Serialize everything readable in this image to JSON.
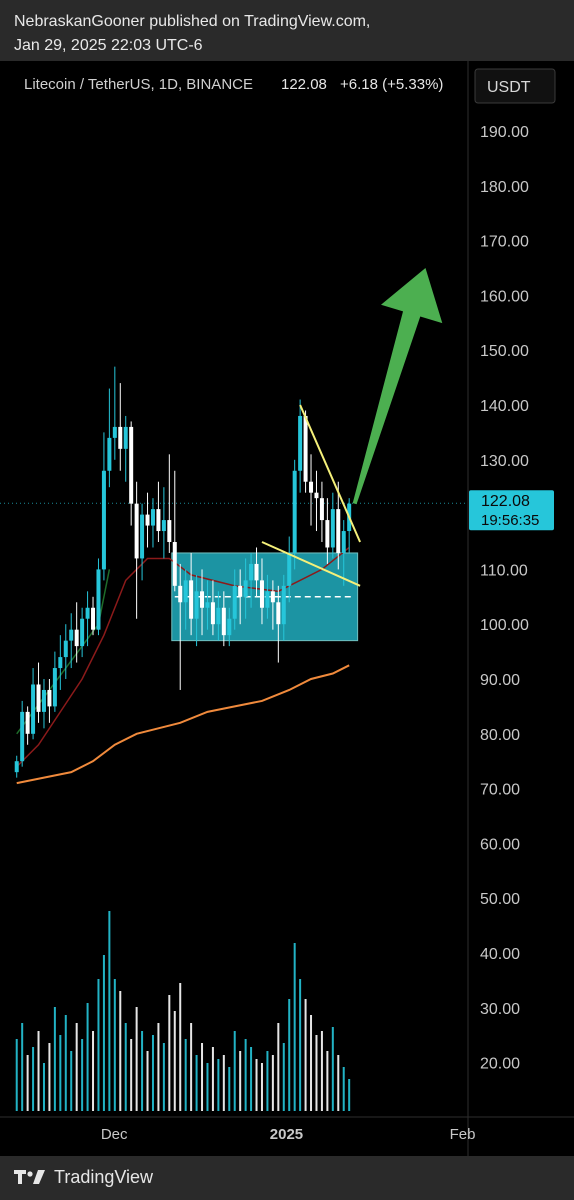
{
  "header": {
    "line1": "NebraskanGooner published on TradingView.com,",
    "line2": "Jan 29, 2025 22:03 UTC-6"
  },
  "footer": {
    "brand": "TradingView"
  },
  "chart_data": {
    "type": "candlestick",
    "symbol_line": "Litecoin / TetherUS, 1D, BINANCE",
    "last_price": "122.08",
    "change_text": "+6.18 (+5.33%)",
    "currency": "USDT",
    "countdown": "19:56:35",
    "ylim": [
      70,
      190
    ],
    "yticks": [
      "190.00",
      "180.00",
      "170.00",
      "160.00",
      "150.00",
      "140.00",
      "130.00",
      "120.00",
      "110.00",
      "100.00",
      "90.00",
      "80.00",
      "70.00",
      "60.00",
      "50.00",
      "40.00",
      "30.00",
      "20.00"
    ],
    "xticks": [
      {
        "label": "Dec",
        "index": 18,
        "bold": false
      },
      {
        "label": "2025",
        "index": 49,
        "bold": true
      },
      {
        "label": "Feb",
        "index": 82,
        "bold": false
      }
    ],
    "colors": {
      "up": "#26c6da",
      "down": "#ffffff",
      "ema_fast": "#1e6b2a",
      "ema_mid": "#8b1a1a",
      "ema_slow": "#f08a3c",
      "range_box": "#26c6da",
      "trendline": "#f5f07a",
      "arrow": "#4caf50"
    },
    "candles": [
      [
        73,
        76,
        72,
        75
      ],
      [
        75,
        86,
        74,
        84
      ],
      [
        84,
        85,
        78,
        80
      ],
      [
        80,
        92,
        79,
        89
      ],
      [
        89,
        93,
        82,
        84
      ],
      [
        84,
        90,
        81,
        88
      ],
      [
        88,
        90,
        82,
        85
      ],
      [
        85,
        95,
        84,
        92
      ],
      [
        92,
        98,
        88,
        94
      ],
      [
        94,
        100,
        90,
        97
      ],
      [
        97,
        102,
        92,
        99
      ],
      [
        99,
        104,
        93,
        96
      ],
      [
        96,
        103,
        94,
        101
      ],
      [
        101,
        106,
        96,
        103
      ],
      [
        103,
        105,
        98,
        99
      ],
      [
        99,
        112,
        98,
        110
      ],
      [
        110,
        135,
        108,
        128
      ],
      [
        128,
        143,
        125,
        134
      ],
      [
        134,
        147,
        130,
        136
      ],
      [
        136,
        144,
        128,
        132
      ],
      [
        132,
        138,
        126,
        136
      ],
      [
        136,
        137,
        118,
        122
      ],
      [
        122,
        126,
        101,
        112
      ],
      [
        112,
        122,
        108,
        120
      ],
      [
        120,
        124,
        114,
        118
      ],
      [
        118,
        123,
        114,
        121
      ],
      [
        121,
        126,
        115,
        117
      ],
      [
        117,
        125,
        112,
        119
      ],
      [
        119,
        131,
        113,
        115
      ],
      [
        115,
        128,
        106,
        107
      ],
      [
        107,
        111,
        88,
        104
      ],
      [
        104,
        110,
        99,
        108
      ],
      [
        108,
        113,
        98,
        101
      ],
      [
        101,
        109,
        96,
        106
      ],
      [
        106,
        110,
        98,
        103
      ],
      [
        103,
        108,
        99,
        104
      ],
      [
        104,
        108,
        98,
        100
      ],
      [
        100,
        106,
        97,
        103
      ],
      [
        103,
        106,
        96,
        98
      ],
      [
        98,
        103,
        96,
        101
      ],
      [
        101,
        110,
        99,
        107
      ],
      [
        107,
        110,
        100,
        105
      ],
      [
        105,
        112,
        101,
        108
      ],
      [
        108,
        113,
        103,
        111
      ],
      [
        111,
        114,
        105,
        108
      ],
      [
        108,
        112,
        100,
        103
      ],
      [
        103,
        109,
        101,
        106
      ],
      [
        106,
        108,
        99,
        104
      ],
      [
        104,
        107,
        93,
        100
      ],
      [
        100,
        109,
        97,
        107
      ],
      [
        107,
        116,
        104,
        113
      ],
      [
        113,
        130,
        110,
        128
      ],
      [
        128,
        141,
        124,
        138
      ],
      [
        138,
        139,
        124,
        126
      ],
      [
        126,
        131,
        118,
        124
      ],
      [
        124,
        128,
        117,
        123
      ],
      [
        123,
        126,
        115,
        119
      ],
      [
        119,
        123,
        111,
        114
      ],
      [
        114,
        124,
        112,
        121
      ],
      [
        121,
        126,
        110,
        113
      ],
      [
        113,
        119,
        107,
        117
      ],
      [
        117,
        123,
        113,
        122
      ]
    ],
    "volumes": [
      18,
      22,
      14,
      16,
      20,
      12,
      17,
      26,
      19,
      24,
      15,
      22,
      18,
      27,
      20,
      33,
      39,
      50,
      33,
      30,
      22,
      18,
      26,
      20,
      15,
      19,
      22,
      17,
      29,
      25,
      32,
      18,
      22,
      14,
      17,
      12,
      16,
      13,
      14,
      11,
      20,
      15,
      18,
      16,
      13,
      12,
      15,
      14,
      22,
      17,
      28,
      42,
      33,
      28,
      24,
      19,
      20,
      15,
      21,
      14,
      11,
      8
    ],
    "range_box": {
      "top": 113,
      "bottom": 97,
      "mid": 105,
      "start": 29,
      "end": 62
    },
    "ema_fast": [
      [
        0,
        80
      ],
      [
        3,
        84
      ],
      [
        6,
        88
      ],
      [
        9,
        92
      ],
      [
        12,
        96
      ],
      [
        15,
        100
      ],
      [
        17,
        110
      ]
    ],
    "ema_mid": [
      [
        0,
        74
      ],
      [
        4,
        78
      ],
      [
        8,
        84
      ],
      [
        12,
        90
      ],
      [
        16,
        98
      ],
      [
        20,
        108
      ],
      [
        24,
        112
      ],
      [
        28,
        112
      ],
      [
        32,
        109
      ],
      [
        40,
        107
      ],
      [
        48,
        106
      ],
      [
        56,
        110
      ],
      [
        61,
        114
      ]
    ],
    "ema_slow": [
      [
        0,
        71
      ],
      [
        5,
        72
      ],
      [
        10,
        73
      ],
      [
        14,
        75
      ],
      [
        18,
        78
      ],
      [
        22,
        80
      ],
      [
        26,
        81
      ],
      [
        30,
        82
      ],
      [
        35,
        84
      ],
      [
        40,
        85
      ],
      [
        45,
        86
      ],
      [
        50,
        88
      ],
      [
        54,
        90
      ],
      [
        58,
        91
      ],
      [
        61,
        92.5
      ]
    ],
    "trendline_upper": [
      [
        52,
        140
      ],
      [
        63,
        115
      ]
    ],
    "trendline_lower": [
      [
        45,
        115
      ],
      [
        63,
        107
      ]
    ],
    "arrow": {
      "from": [
        62,
        122
      ],
      "to": [
        75,
        165
      ]
    }
  }
}
